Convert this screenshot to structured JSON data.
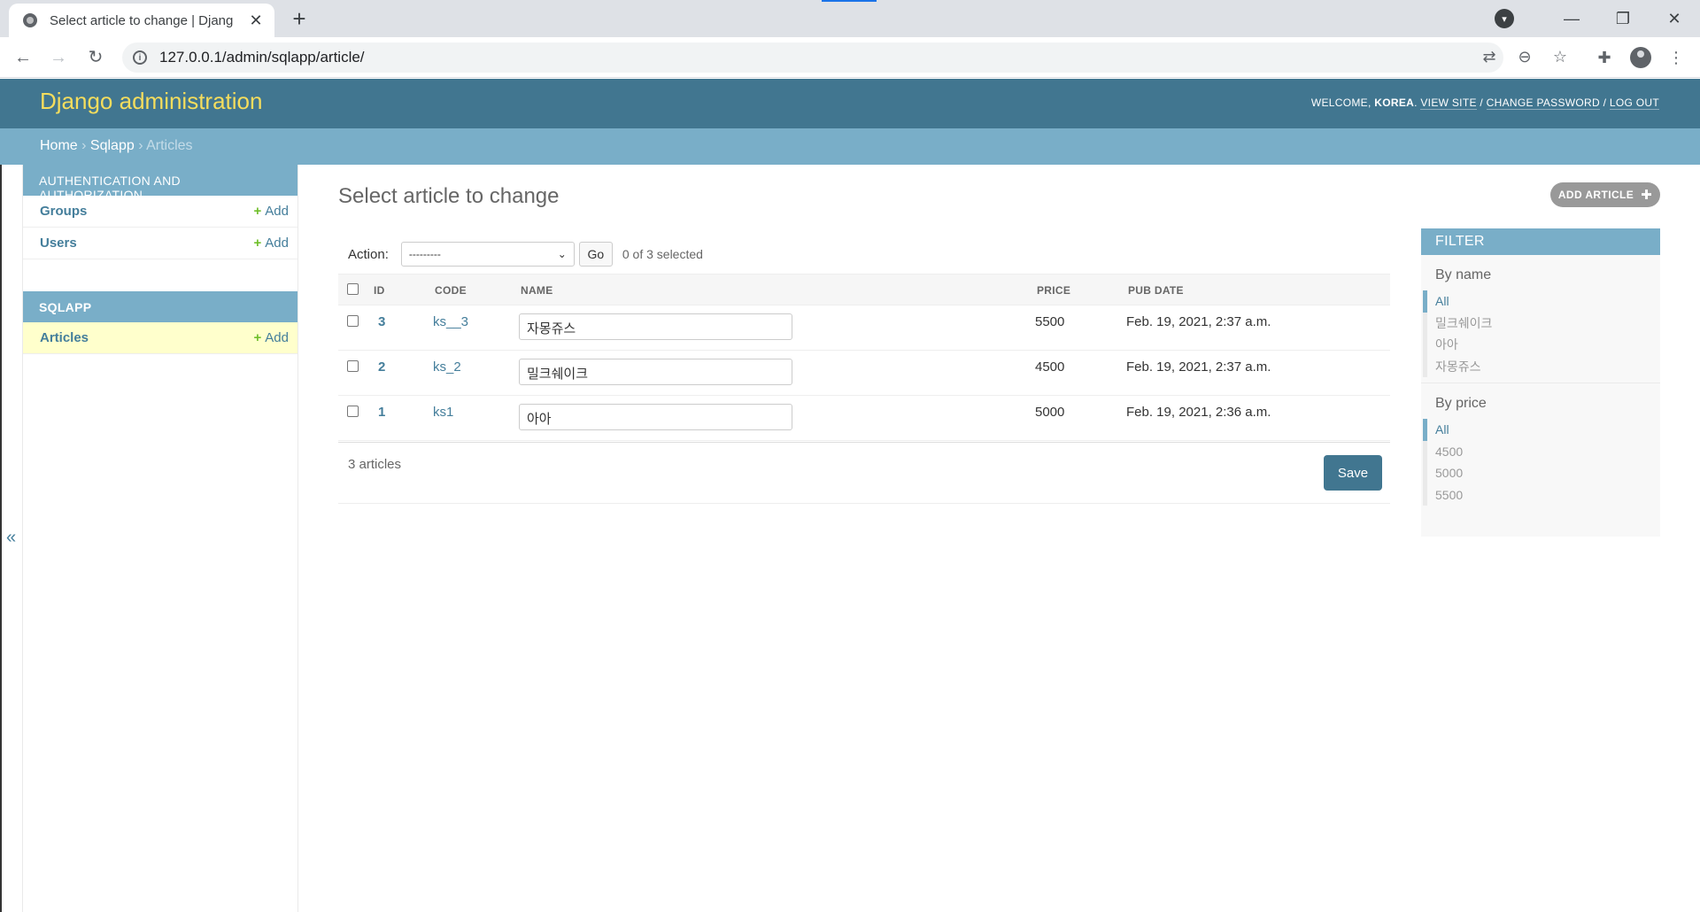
{
  "browser": {
    "tab_title": "Select article to change | Djang",
    "url": "127.0.0.1/admin/sqlapp/article/"
  },
  "header": {
    "branding": "Django administration",
    "welcome": "WELCOME,",
    "username": "KOREA",
    "view_site": "VIEW SITE",
    "change_password": "CHANGE PASSWORD",
    "log_out": "LOG OUT",
    "sep": "/"
  },
  "breadcrumbs": {
    "home": "Home",
    "app": "Sqlapp",
    "current": "Articles",
    "sep": "›"
  },
  "sidebar": {
    "modules": [
      {
        "caption": "AUTHENTICATION AND AUTHORIZATION",
        "models": [
          {
            "name": "Groups",
            "add": "Add"
          },
          {
            "name": "Users",
            "add": "Add"
          }
        ]
      },
      {
        "caption": "SQLAPP",
        "models": [
          {
            "name": "Articles",
            "add": "Add"
          }
        ]
      }
    ],
    "collapse_icon": "«"
  },
  "content": {
    "title": "Select article to change",
    "add_button": "ADD ARTICLE",
    "action_label": "Action:",
    "action_selected": "---------",
    "go": "Go",
    "counter": "0 of 3 selected",
    "columns": {
      "id": "ID",
      "code": "CODE",
      "name": "NAME",
      "price": "PRICE",
      "pub_date": "PUB DATE"
    },
    "rows": [
      {
        "id": "3",
        "code": "ks__3",
        "name": "자몽쥬스",
        "price": "5500",
        "pub_date": "Feb. 19, 2021, 2:37 a.m."
      },
      {
        "id": "2",
        "code": "ks_2",
        "name": "밀크쉐이크",
        "price": "4500",
        "pub_date": "Feb. 19, 2021, 2:37 a.m."
      },
      {
        "id": "1",
        "code": "ks1",
        "name": "아아",
        "price": "5000",
        "pub_date": "Feb. 19, 2021, 2:36 a.m."
      }
    ],
    "result_count": "3 articles",
    "save": "Save"
  },
  "filter": {
    "title": "FILTER",
    "groups": [
      {
        "title": "By name",
        "options": [
          "All",
          "밀크쉐이크",
          "아아",
          "자몽쥬스"
        ]
      },
      {
        "title": "By price",
        "options": [
          "All",
          "4500",
          "5000",
          "5500"
        ]
      }
    ]
  }
}
